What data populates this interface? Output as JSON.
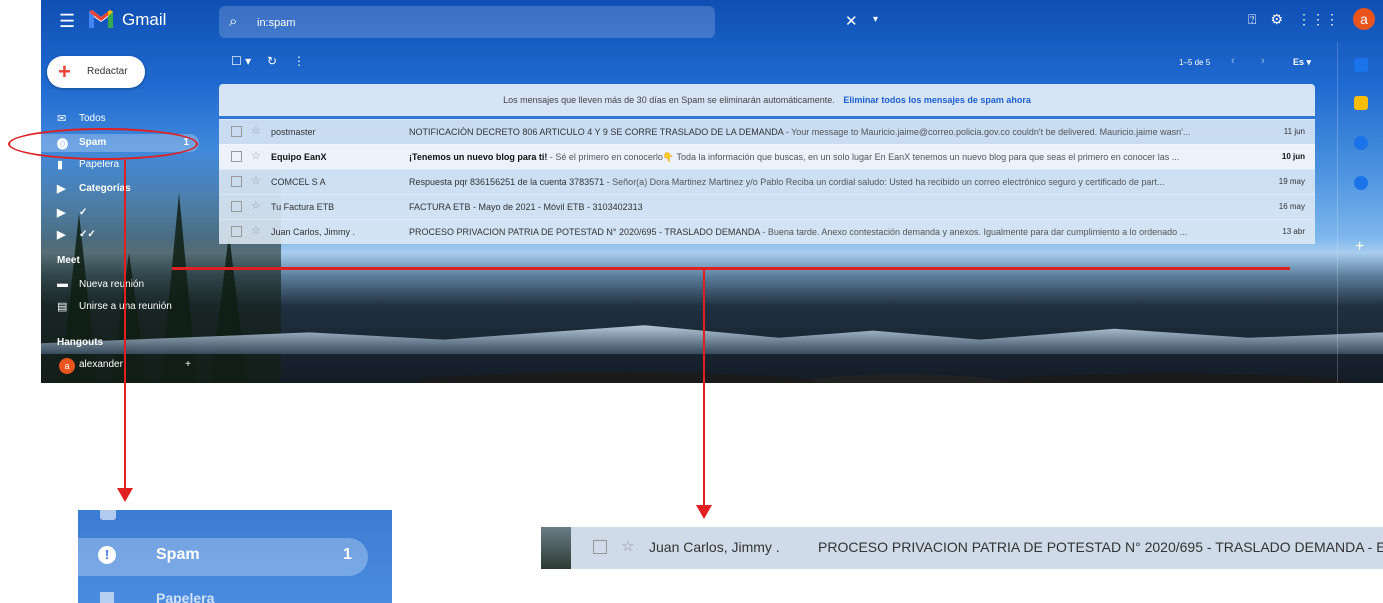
{
  "app": {
    "brand": "Gmail"
  },
  "search": {
    "value": "in:spam",
    "clear_icon": "✕",
    "options_icon": "▾"
  },
  "topbar": {
    "avatar_letter": "a"
  },
  "compose": {
    "label": "Redactar"
  },
  "sidebar": {
    "items": [
      {
        "label": "Todos",
        "count": ""
      },
      {
        "label": "Spam",
        "count": "1"
      },
      {
        "label": "Papelera",
        "count": ""
      },
      {
        "label": "Categorías",
        "count": ""
      },
      {
        "label": "✓",
        "count": ""
      },
      {
        "label": "✓✓",
        "count": ""
      }
    ],
    "meet_heading": "Meet",
    "meet_items": [
      {
        "label": "Nueva reunión"
      },
      {
        "label": "Unirse a una reunión"
      }
    ],
    "hangouts_heading": "Hangouts",
    "hangouts_user": "alexander",
    "hangouts_avatar": "a",
    "hangouts_add": "+"
  },
  "toolbar": {
    "pagination": "1–5 de 5",
    "prev": "‹",
    "next": "›",
    "language": "Es ▾"
  },
  "banner": {
    "text": "Los mensajes que lleven más de 30 días en Spam se eliminarán automáticamente.",
    "link": "Eliminar todos los mensajes de spam ahora"
  },
  "emails": [
    {
      "from": "postmaster",
      "subject": "NOTIFICACIÓN DECRETO 806 ARTICULO 4 Y 9 SE CORRE TRASLADO DE LA DEMANDA",
      "snippet": " - Your message to Mauricio.jaime@correo.policia.gov.co couldn't be delivered. Mauricio.jaime wasn'...",
      "date": "11 jun",
      "unread": false
    },
    {
      "from": "Equipo EanX",
      "subject": "¡Tenemos un nuevo blog para ti!",
      "snippet": " - Sé el primero en conocerlo👇 Toda la información que buscas, en un solo lugar En EanX tenemos un nuevo blog para que seas el primero en conocer las ...",
      "date": "10 jun",
      "unread": true
    },
    {
      "from": "COMCEL S A",
      "subject": "Respuesta pqr 836156251 de la cuenta 3783571",
      "snippet": " - Señor(a) Dora Martinez Martinez y/o Pablo Reciba un cordial saludo: Usted ha recibido un correo electrónico seguro y certificado de part...",
      "date": "19 may",
      "unread": false
    },
    {
      "from": "Tu Factura ETB",
      "subject": "FACTURA ETB - Mayo de 2021 - Móvil ETB - 3103402313",
      "snippet": "",
      "date": "16 may",
      "unread": false
    },
    {
      "from": "Juan Carlos, Jimmy .",
      "subject": "PROCESO PRIVACION PATRIA DE POTESTAD N° 2020/695 - TRASLADO DEMANDA",
      "snippet": " - Buena tarde. Anexo contestación demanda y anexos. Igualmente para dar cumplimiento a lo ordenado ...",
      "date": "13 abr",
      "unread": false
    }
  ],
  "zoom_spam": {
    "label": "Spam",
    "count": "1",
    "below": "Papelera"
  },
  "zoom_row": {
    "from": "Juan Carlos, Jimmy .",
    "subject": "PROCESO PRIVACION PATRIA DE POTESTAD N° 2020/695 - TRASLADO DEMANDA - E"
  },
  "colors": {
    "accent": "#1a73e8",
    "annotation_red": "#e02020",
    "avatar": "#e8541c"
  }
}
